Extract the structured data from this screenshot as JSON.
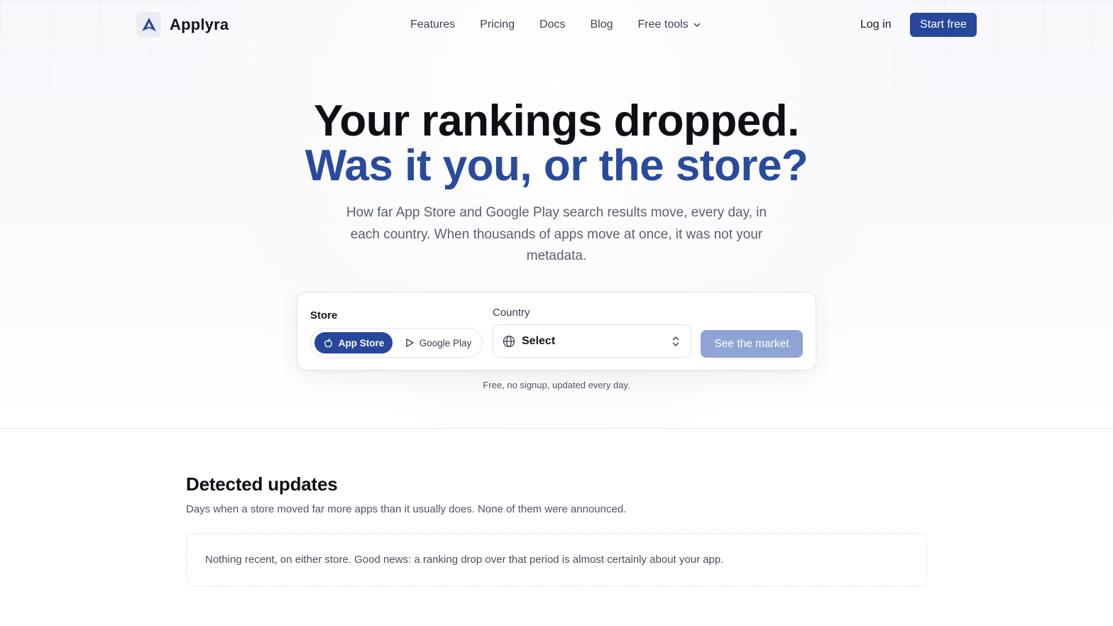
{
  "nav": {
    "brand": "Applyra",
    "links": [
      "Features",
      "Pricing",
      "Docs",
      "Blog",
      "Free tools"
    ],
    "login": "Log in",
    "cta": "Start free"
  },
  "hero": {
    "title_line1": "Your rankings dropped.",
    "title_line2": "Was it you, or the store?",
    "subtitle": "How far App Store and Google Play search results move, every day, in each country. When thousands of apps move at once, it was not your metadata."
  },
  "search": {
    "store_label": "Store",
    "store_options": [
      "App Store",
      "Google Play"
    ],
    "selected_store": "App Store",
    "country_label": "Country",
    "country_value": "Select",
    "submit_label": "See the market",
    "note": "Free, no signup, updated every day."
  },
  "updates": {
    "title": "Detected updates",
    "description": "Days when a store moved far more apps than it usually does. None of them were announced.",
    "empty_message": "Nothing recent, on either store. Good news: a ranking drop over that period is almost certainly about your app."
  },
  "colors": {
    "accent": "#26479a",
    "accent_text": "#2a4a9c",
    "disabled_button": "#8fa4d3"
  }
}
